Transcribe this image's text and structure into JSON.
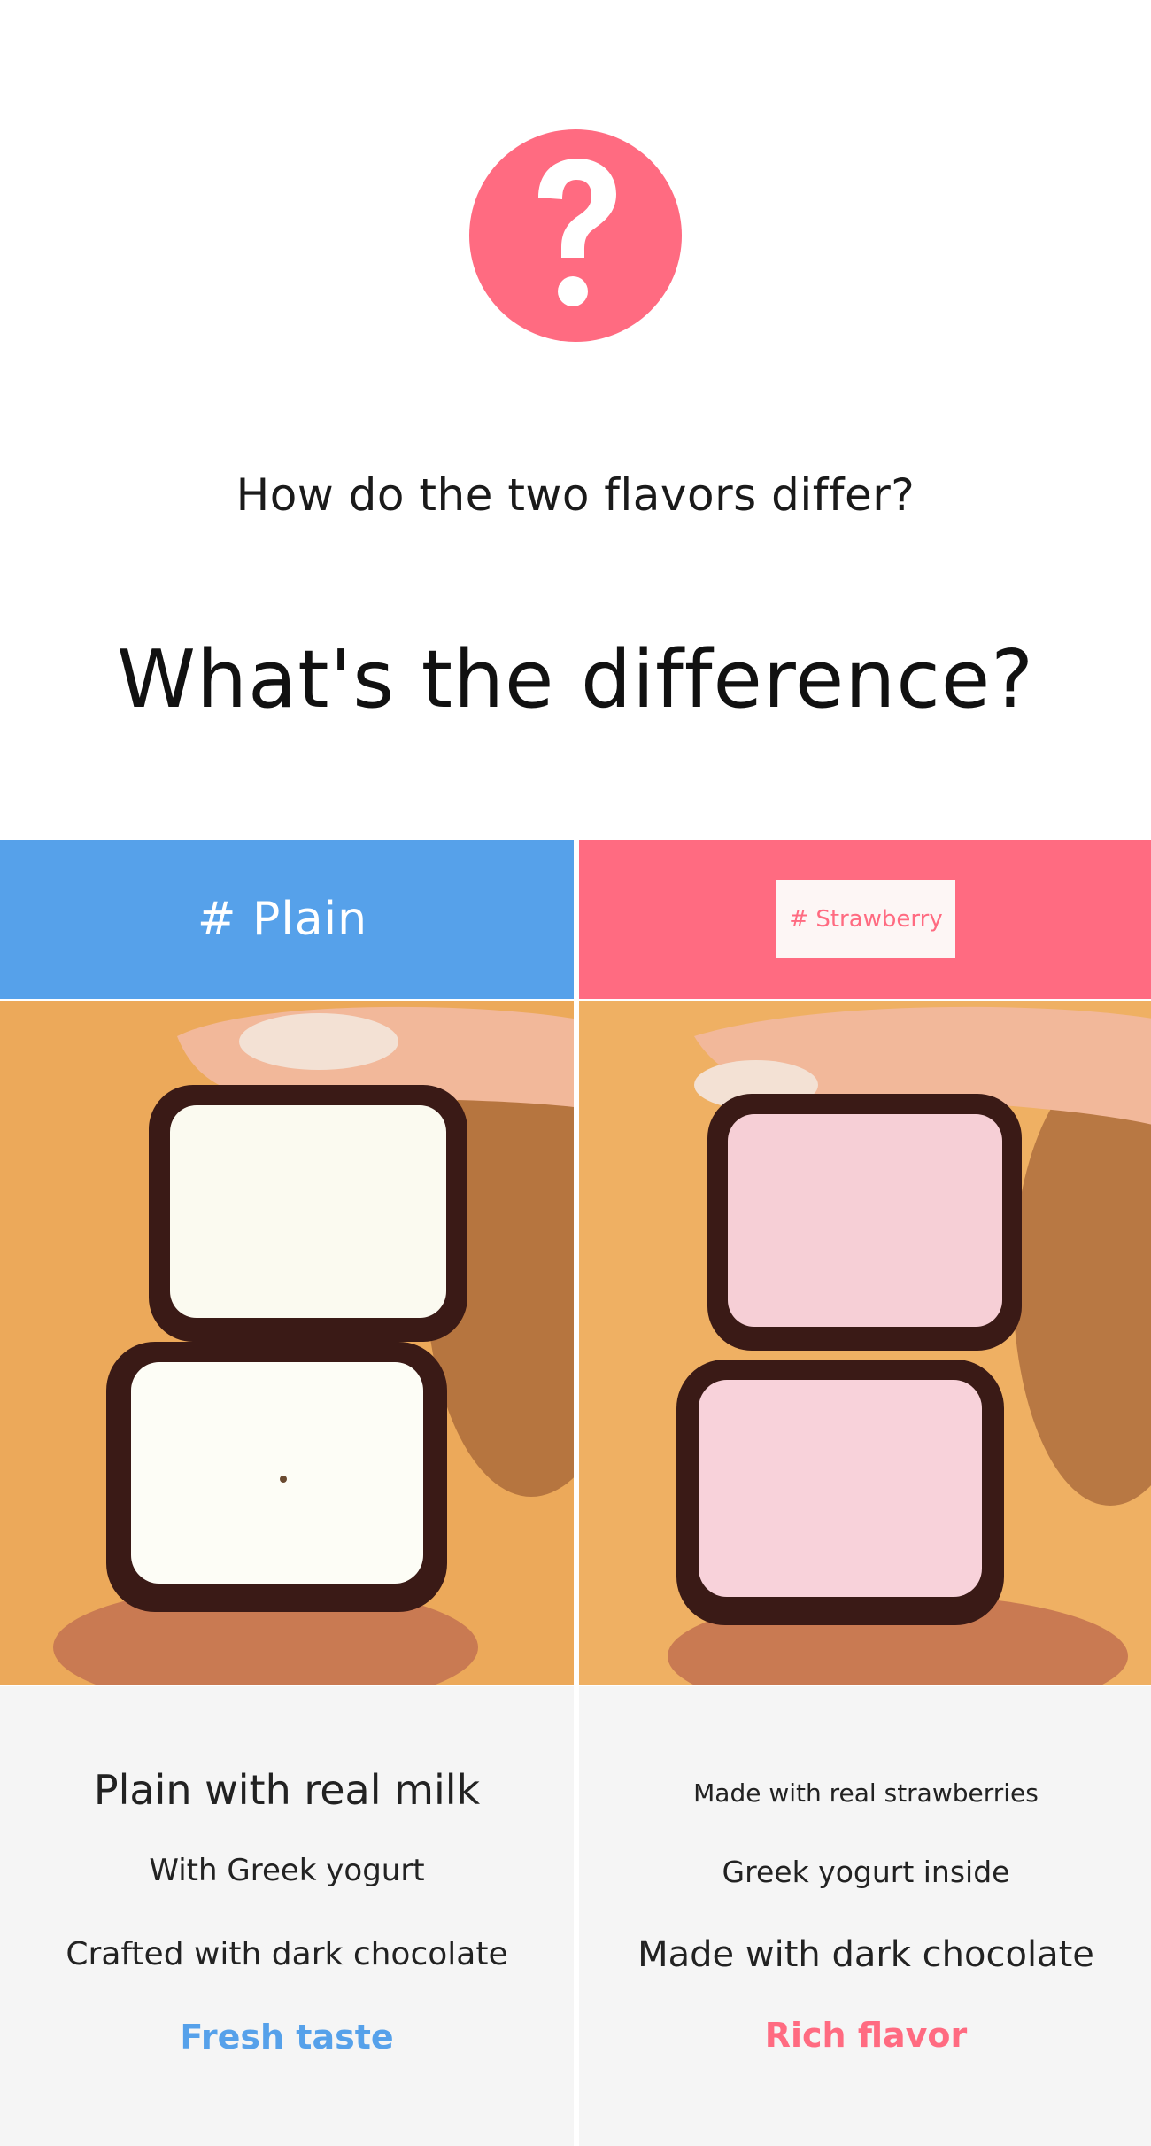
{
  "badge": {
    "icon": "question-mark-icon",
    "color": "#ff6b81"
  },
  "subheading": "How do the two flavors differ?",
  "heading": "What's the difference?",
  "columns": {
    "plain": {
      "tag": "# Plain",
      "color": "#56a1ea",
      "photo": "plain-bar-cross-section",
      "lines": [
        "Plain with real milk",
        "With Greek yogurt",
        "Crafted with dark chocolate"
      ],
      "highlight": "Fresh taste"
    },
    "strawberry": {
      "tag": "# Strawberry",
      "color": "#ff6b81",
      "photo": "strawberry-bar-cross-section",
      "lines": [
        "Made with real strawberries",
        "Greek yogurt inside",
        "Made with dark chocolate"
      ],
      "highlight": "Rich flavor"
    }
  }
}
